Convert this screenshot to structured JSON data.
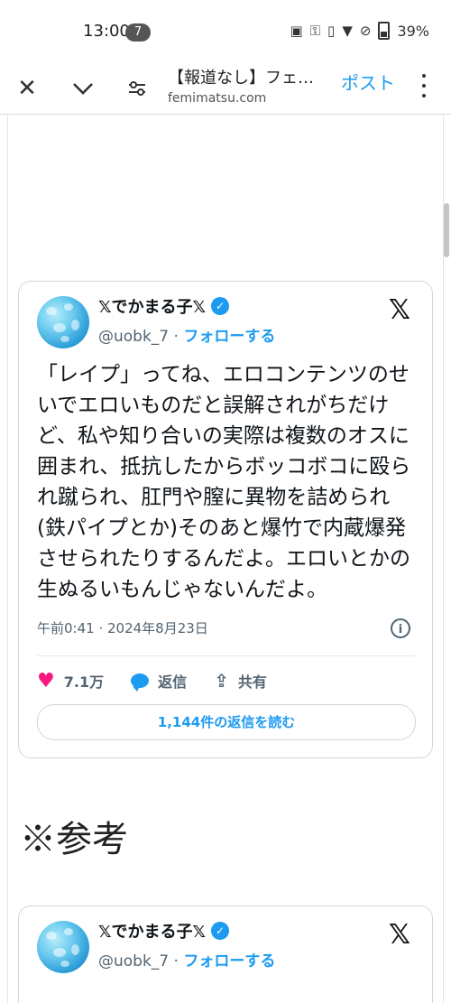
{
  "status_bar": {
    "time": "13:00",
    "notification_count": "7",
    "battery": "39%"
  },
  "browser": {
    "page_title": "【報道なし】フェ…",
    "domain": "femimatsu.com",
    "post_label": "ポスト"
  },
  "tweets": [
    {
      "author": "𝕏でかまる子𝕏",
      "handle": "@uobk_7",
      "separator": "·",
      "follow": "フォローする",
      "text": "「レイプ」ってね、エロコンテンツのせいでエロいものだと誤解されがちだけど、私や知り合いの実際は複数のオスに囲まれ、抵抗したからボッコボコに殴られ蹴られ、肛門や膣に異物を詰められ(鉄パイプとか)そのあと爆竹で内蔵爆発させられたりするんだよ。エロいとかの生ぬるいもんじゃないんだよ。",
      "timestamp": "午前0:41 · 2024年8月23日",
      "likes": "7.1万",
      "reply_label": "返信",
      "share_label": "共有",
      "read_replies": "1,144件の返信を読む"
    },
    {
      "author": "𝕏でかまる子𝕏",
      "handle": "@uobk_7",
      "separator": "·",
      "follow": "フォローする"
    }
  ],
  "section_heading": "※参考",
  "icons": {
    "close": "close-icon",
    "dropdown": "chevron-down-icon",
    "page_settings": "tune-icon",
    "menu": "more-vert-icon",
    "verified": "verified-badge-icon",
    "platform": "x-logo-icon",
    "info": "info-icon",
    "like": "heart-icon",
    "reply": "reply-bubble-icon",
    "share": "share-icon"
  },
  "colors": {
    "accent": "#1d9bf0",
    "like": "#f91880",
    "secondary_text": "#536471",
    "border": "#cfd9de"
  }
}
